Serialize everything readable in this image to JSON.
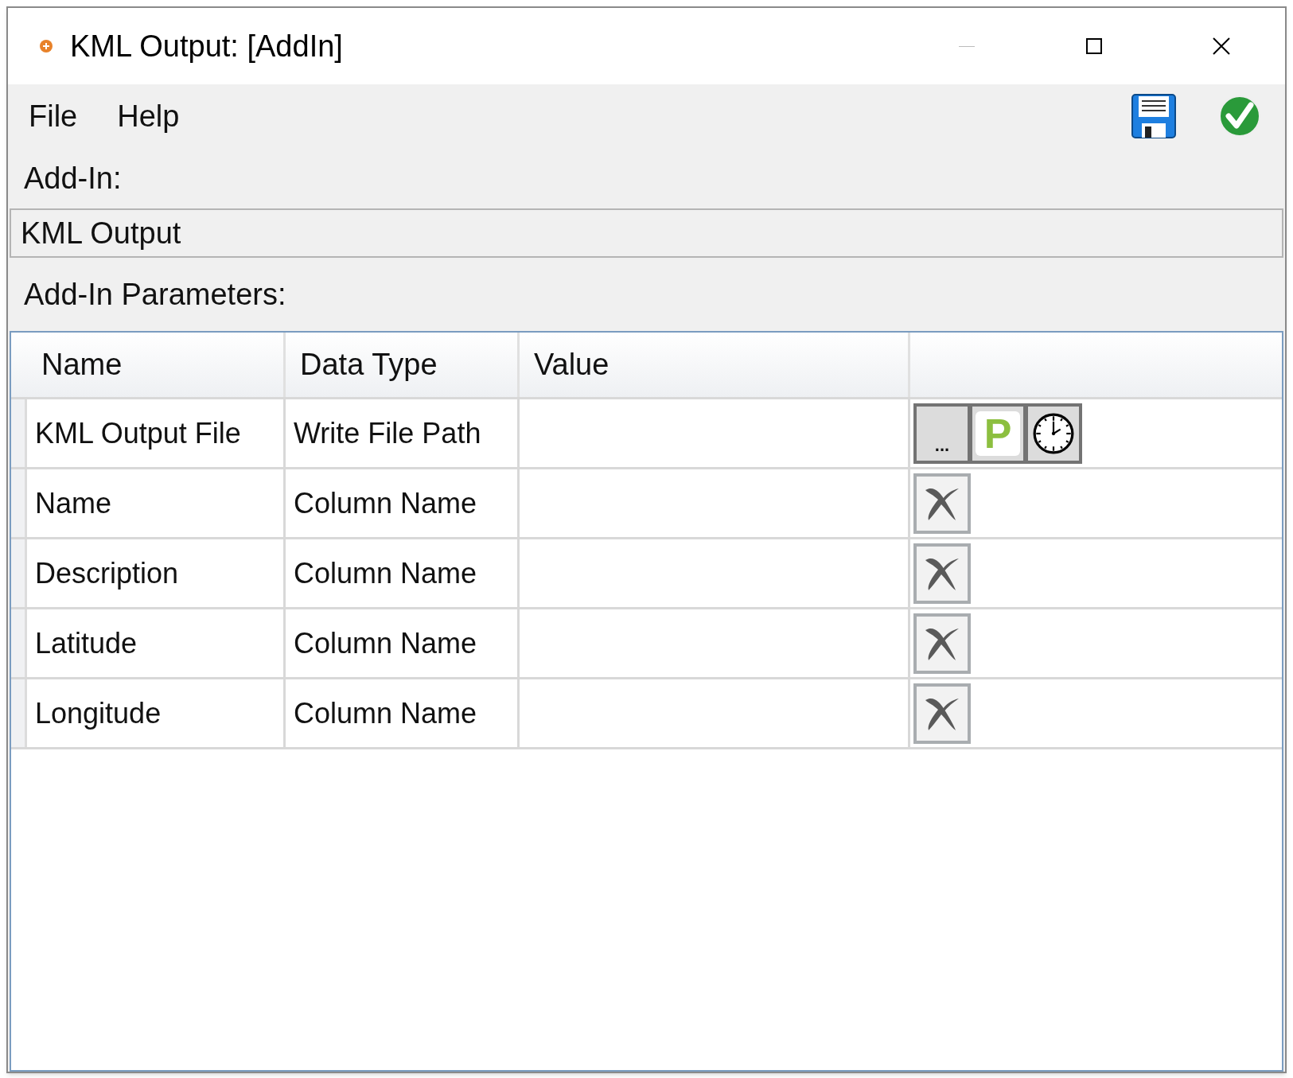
{
  "window": {
    "title": "KML Output: [AddIn]"
  },
  "menu": [
    "File",
    "Help"
  ],
  "toolbar": [
    {
      "kind": "save"
    },
    {
      "kind": "confirm"
    }
  ],
  "addin": {
    "label": "Add-In:",
    "value": "KML Output"
  },
  "parameters": {
    "label": "Add-In Parameters:",
    "columns": [
      "Name",
      "Data Type",
      "Value"
    ],
    "rows": [
      {
        "name": "KML Output File",
        "data_type": "Write File Path",
        "actions": [
          {
            "kind": "browse",
            "label": "..."
          },
          {
            "kind": "parameter",
            "label": "P"
          },
          {
            "kind": "time"
          }
        ]
      },
      {
        "name": "Name",
        "data_type": "Column Name",
        "actions": [
          {
            "kind": "clear"
          }
        ]
      },
      {
        "name": "Description",
        "data_type": "Column Name",
        "actions": [
          {
            "kind": "clear"
          }
        ]
      },
      {
        "name": "Latitude",
        "data_type": "Column Name",
        "actions": [
          {
            "kind": "clear"
          }
        ]
      },
      {
        "name": "Longitude",
        "data_type": "Column Name",
        "actions": [
          {
            "kind": "clear"
          }
        ]
      }
    ]
  }
}
